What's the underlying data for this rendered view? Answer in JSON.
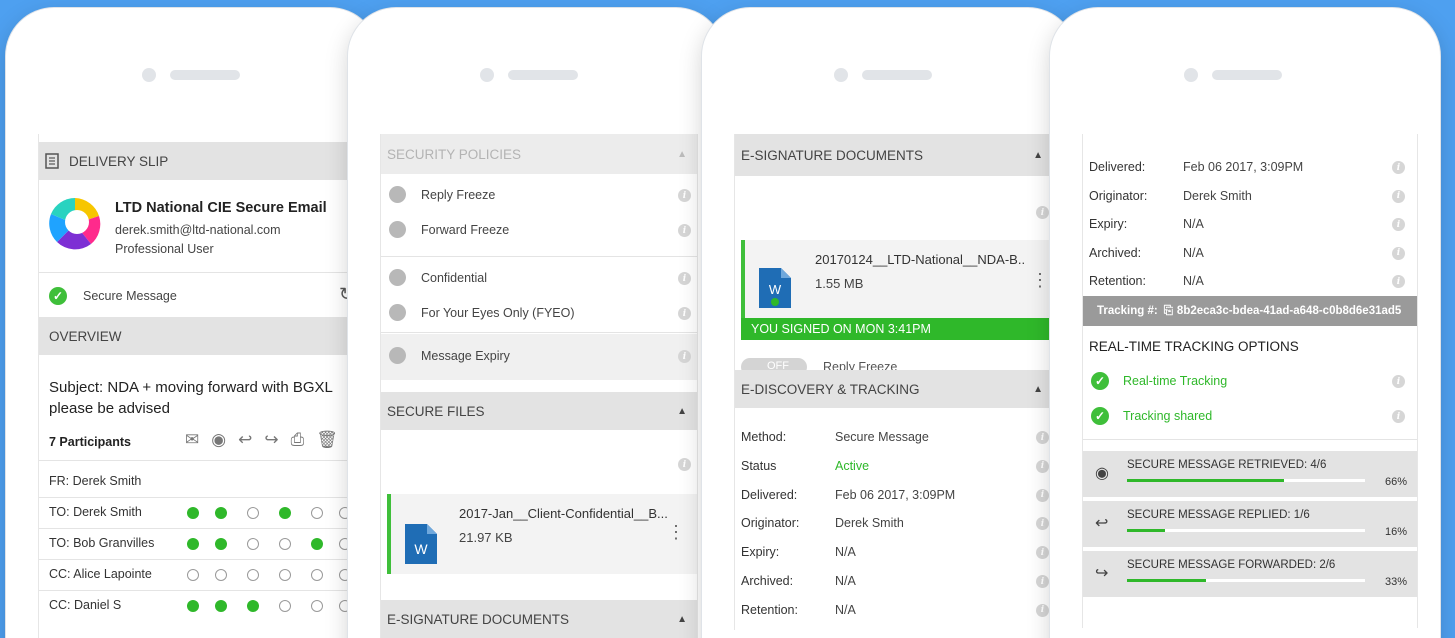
{
  "phone1": {
    "delivery_slip": "DELIVERY SLIP",
    "sender_name": "LTD National CIE Secure Email",
    "sender_email": "derek.smith@ltd-national.com",
    "sender_role": "Professional User",
    "secure_message": "Secure Message",
    "overview": "OVERVIEW",
    "subject": "Subject: NDA + moving forward with BGXL please be advised",
    "participants": "7 Participants",
    "rows": [
      {
        "label": "FR: Derek Smith",
        "dots": []
      },
      {
        "label": "TO: Derek Smith",
        "dots": [
          1,
          1,
          0,
          1,
          0,
          0
        ]
      },
      {
        "label": "TO: Bob Granvilles",
        "dots": [
          1,
          1,
          0,
          0,
          1,
          0
        ]
      },
      {
        "label": "CC: Alice Lapointe",
        "dots": [
          0,
          0,
          0,
          0,
          0,
          0
        ]
      },
      {
        "label": "CC: Daniel S",
        "dots": [
          1,
          1,
          1,
          0,
          0,
          0
        ]
      }
    ]
  },
  "phone2": {
    "security_policies": "SECURITY POLICIES",
    "policies": [
      "Reply Freeze",
      "Forward Freeze",
      "Confidential",
      "For Your Eyes Only (FYEO)",
      "Message Expiry"
    ],
    "secure_files": "SECURE FILES",
    "file_name": "2017-Jan__Client-Confidential__B...",
    "file_size": "21.97 KB",
    "e_signature": "E-SIGNATURE DOCUMENTS",
    "word_letter": "W"
  },
  "phone3": {
    "e_signature": "E-SIGNATURE DOCUMENTS",
    "file_name": "20170124__LTD-National__NDA-B..",
    "file_size": "1.55 MB",
    "signed_banner": "YOU SIGNED ON MON 3:41PM",
    "toggle_label": "OFF",
    "reply_freeze": "Reply Freeze",
    "e_discovery": "E-DISCOVERY & TRACKING",
    "word_letter": "W",
    "details": [
      {
        "label": "Method:",
        "value": "Secure Message"
      },
      {
        "label": "Status",
        "value": "Active"
      },
      {
        "label": "Delivered:",
        "value": "Feb 06 2017, 3:09PM"
      },
      {
        "label": "Originator:",
        "value": "Derek Smith"
      },
      {
        "label": "Expiry:",
        "value": "N/A"
      },
      {
        "label": "Archived:",
        "value": "N/A"
      },
      {
        "label": "Retention:",
        "value": "N/A"
      }
    ]
  },
  "phone4": {
    "details": [
      {
        "label": "Delivered:",
        "value": "Feb 06 2017, 3:09PM"
      },
      {
        "label": "Originator:",
        "value": "Derek Smith"
      },
      {
        "label": "Expiry:",
        "value": "N/A"
      },
      {
        "label": "Archived:",
        "value": "N/A"
      },
      {
        "label": "Retention:",
        "value": "N/A"
      }
    ],
    "tracking_label": "Tracking #:",
    "tracking_id": "8b2eca3c-bdea-41ad-a648-c0b8d6e31ad5",
    "realtime_header": "REAL-TIME TRACKING OPTIONS",
    "options": [
      "Real-time Tracking",
      "Tracking shared"
    ],
    "stats": [
      {
        "label": "SECURE MESSAGE RETRIEVED:",
        "count": "4/6",
        "percent": "66%",
        "fraction": 0.66
      },
      {
        "label": "SECURE MESSAGE REPLIED:",
        "count": "1/6",
        "percent": "16%",
        "fraction": 0.16
      },
      {
        "label": "SECURE MESSAGE FORWARDED:",
        "count": "2/6",
        "percent": "33%",
        "fraction": 0.33
      }
    ]
  },
  "colors": {
    "background": "#4ea0f0",
    "green": "#2fb82a",
    "header_gray": "#e3e3e3",
    "word_blue": "#1f6db5"
  }
}
